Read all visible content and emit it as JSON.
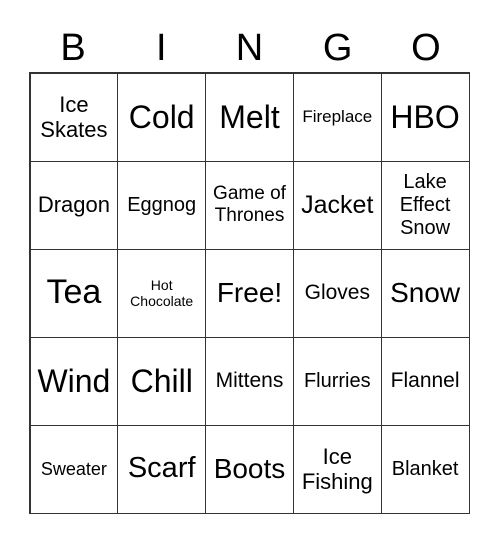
{
  "header": [
    "B",
    "I",
    "N",
    "G",
    "O"
  ],
  "cells": [
    "Ice Skates",
    "Cold",
    "Melt",
    "Fireplace",
    "HBO",
    "Dragon",
    "Eggnog",
    "Game of Thrones",
    "Jacket",
    "Lake Effect Snow",
    "Tea",
    "Hot Chocolate",
    "Free!",
    "Gloves",
    "Snow",
    "Wind",
    "Chill",
    "Mittens",
    "Flurries",
    "Flannel",
    "Sweater",
    "Scarf",
    "Boots",
    "Ice Fishing",
    "Blanket"
  ]
}
